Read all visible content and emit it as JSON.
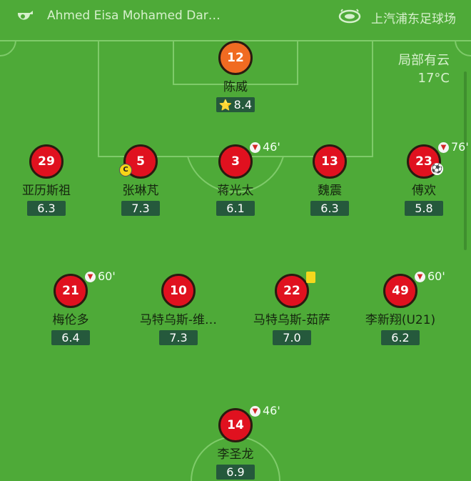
{
  "header": {
    "referee": "Ahmed Eisa Mohamed Dar…",
    "stadium": "上汽浦东足球场",
    "referee_icon": "whistle-icon",
    "stadium_icon": "stadium-icon"
  },
  "weather": {
    "condition": "局部有云",
    "temperature": "17°C"
  },
  "colors": {
    "pitch": "#4eaa38",
    "player": "#e0111f",
    "goalkeeper": "#f06b22",
    "rating_bg": "#25593c"
  },
  "players": {
    "gk": {
      "number": "12",
      "name": "陈威",
      "rating": "8.4",
      "star": "⭐"
    },
    "d1": {
      "number": "29",
      "name": "亚历斯祖",
      "rating": "6.3"
    },
    "d2": {
      "number": "5",
      "name": "张琳芃",
      "rating": "7.3",
      "captain": "C"
    },
    "d3": {
      "number": "3",
      "name": "蒋光太",
      "rating": "6.1",
      "sub_time": "46'"
    },
    "d4": {
      "number": "13",
      "name": "魏震",
      "rating": "6.3"
    },
    "d5": {
      "number": "23",
      "name": "傅欢",
      "rating": "5.8",
      "sub_time": "76'"
    },
    "m1": {
      "number": "21",
      "name": "梅伦多",
      "rating": "6.4",
      "sub_time": "60'"
    },
    "m2": {
      "number": "10",
      "name": "马特乌斯-维…",
      "rating": "7.3"
    },
    "m3": {
      "number": "22",
      "name": "马特乌斯-茹萨",
      "rating": "7.0"
    },
    "m4": {
      "number": "49",
      "name": "李新翔(U21)",
      "rating": "6.2",
      "sub_time": "60'"
    },
    "f1": {
      "number": "14",
      "name": "李圣龙",
      "rating": "6.9",
      "sub_time": "46'"
    }
  }
}
